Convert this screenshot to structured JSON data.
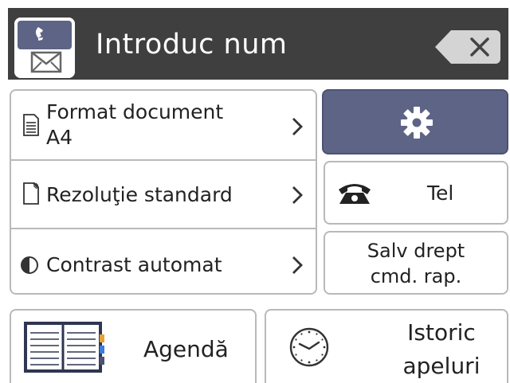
{
  "header": {
    "title": "Introduc num",
    "app_icon": "fax-phone-envelope-icon",
    "backspace_icon": "backspace-icon"
  },
  "options": [
    {
      "icon": "document-format-icon",
      "label_line1": "Format document",
      "label_line2": "A4"
    },
    {
      "icon": "resolution-icon",
      "label": "Rezoluţie standard"
    },
    {
      "icon": "contrast-icon",
      "label": "Contrast automat"
    }
  ],
  "buttons": {
    "settings_icon": "gear-icon",
    "tel_label": "Tel",
    "tel_icon": "telephone-icon",
    "salv_line1": "Salv drept",
    "salv_line2": "cmd. rap.",
    "agenda_label": "Agendă",
    "agenda_icon": "address-book-icon",
    "istoric_line1": "Istoric",
    "istoric_line2": "apeluri",
    "istoric_icon": "clock-icon"
  },
  "colors": {
    "header_bg": "#3f3f3f",
    "settings_bg": "#5e6486",
    "border": "#b9b9b9"
  }
}
